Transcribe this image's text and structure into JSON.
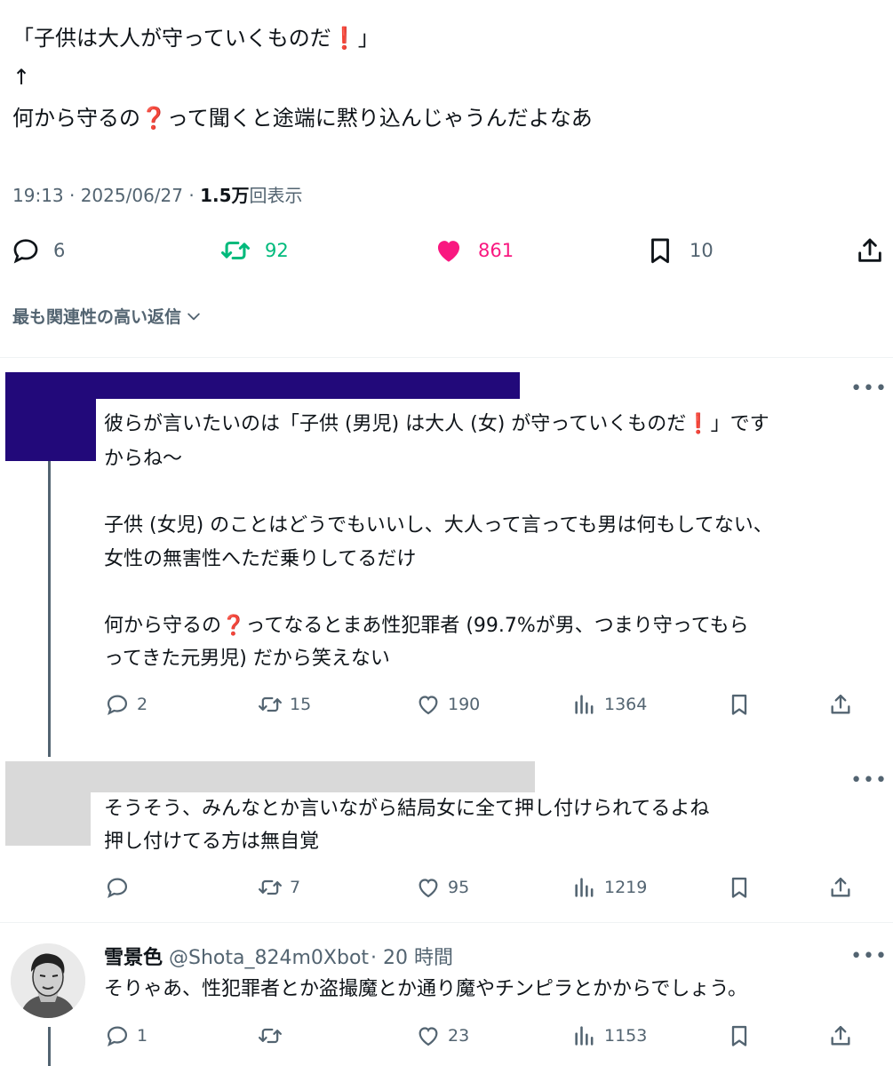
{
  "tweet": {
    "line1": "「子供は大人が守っていくものだ",
    "line1_mark": "❗",
    "line1_end": "」",
    "arrow": "↑",
    "line3a": "何から守るの",
    "line3_mark": "❓",
    "line3b": "って聞くと途端に黙り込んじゃうんだよなあ",
    "time": "19:13 · 2025/06/27 · ",
    "views": "1.5万",
    "views_label": "回表示"
  },
  "stats": {
    "replies": "6",
    "retweets": "92",
    "likes": "861",
    "bookmarks": "10"
  },
  "sort_label": "最も関連性の高い返信",
  "colors": {
    "retweet": "#00ba7c",
    "like": "#f91880",
    "redact_purple": "#22097a",
    "redact_gray": "#d9d9d9",
    "muted": "#536471"
  },
  "reply1": {
    "p1a": "彼らが言いたいのは「子供 (男児) は大人 (女) が守っていくものだ",
    "p1_mark": "❗",
    "p1b": "」です",
    "p1c": "からね〜",
    "p2a": "子供 (女児) のことはどうでもいいし、大人って言っても男は何もしてない、",
    "p2b": "女性の無害性へただ乗りしてるだけ",
    "p3a": "何から守るの",
    "p3_mark": "❓",
    "p3b": "ってなるとまあ性犯罪者 (99.7%が男、つまり守ってもら",
    "p3c": "ってきた元男児) だから笑えない",
    "replies": "2",
    "retweets": "15",
    "likes": "190",
    "views": "1364"
  },
  "reply2": {
    "line1": "そうそう、みんなとか言いながら結局女に全て押し付けられてるよね",
    "line2": "押し付けてる方は無自覚",
    "retweets": "7",
    "likes": "95",
    "views": "1219"
  },
  "reply3": {
    "name": "雪景色",
    "handle": "@Shota_824m0Xbot",
    "time": "· 20 時間",
    "text": "そりゃあ、性犯罪者とか盗撮魔とか通り魔やチンピラとかからでしょう。",
    "replies": "1",
    "likes": "23",
    "views": "1153"
  }
}
